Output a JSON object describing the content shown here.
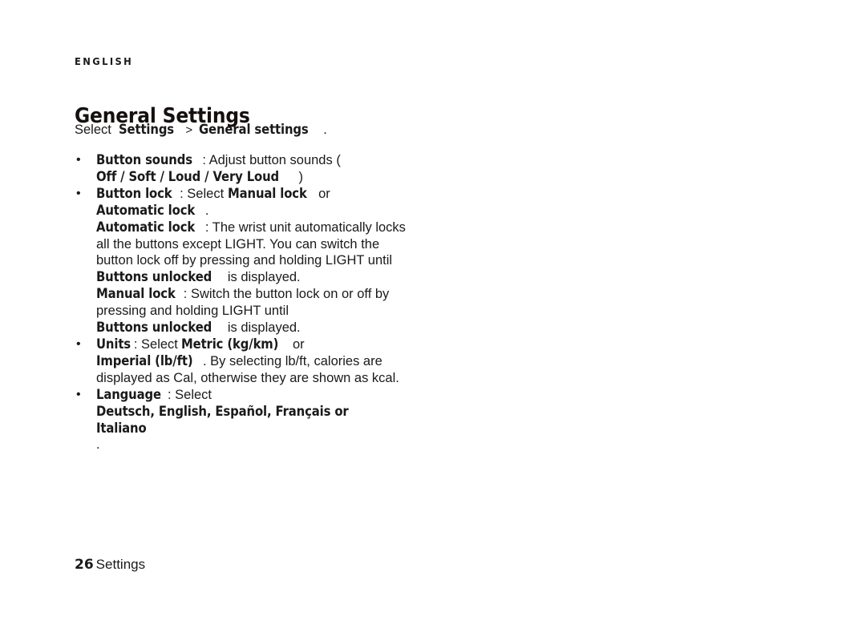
{
  "page": {
    "language_label": "ENGLISH",
    "title": "General Settings",
    "intro": {
      "lead": "Select",
      "path_1": "Settings",
      "separator": ">",
      "path_2": "General settings",
      "period": "."
    },
    "footer": {
      "page_number": "26",
      "section": "Settings"
    },
    "colors": {
      "background": "#ffffff",
      "text": "#1a1a1a"
    },
    "bullet_glyph": "•"
  },
  "settings_list": [
    {
      "name": "button-sounds",
      "term": "Button sounds",
      "colon": ":",
      "desc_lead": " Adjust button sounds (",
      "options_bold": "Off / Soft / Loud / Very Loud",
      "desc_tail": ")"
    },
    {
      "name": "button-lock",
      "term": "Button lock",
      "colon": ":",
      "desc_lead": " Select ",
      "option_a": "Manual lock",
      "conjunction": " or ",
      "option_b": "Automatic lock",
      "desc_tail": "."
    },
    {
      "name": "units",
      "term": "Units",
      "colon": ":",
      "desc_lead": " Select ",
      "option_a": "Metric (kg/km)",
      "conjunction": " or ",
      "option_b": "Imperial (lb/ft)",
      "desc_tail": ". By selecting lb/ft, calories are displayed as Cal, otherwise they are shown as kcal."
    },
    {
      "name": "language",
      "term": "Language",
      "colon": ":",
      "desc_lead": " Select ",
      "options_bold": "Deutsch, English, Español, Français or Italiano",
      "desc_tail": "."
    }
  ],
  "sub_paragraphs": [
    {
      "name": "automatic-lock",
      "term": "Automatic lock",
      "colon": ":",
      "text_1": " The wrist unit automatically locks all the buttons except LIGHT. You can switch the button lock off by pressing and holding LIGHT until ",
      "inline_bold": "Buttons unlocked",
      "text_2": " is displayed."
    },
    {
      "name": "manual-lock",
      "term": "Manual lock",
      "colon": ":",
      "text_1": " Switch the button lock on or off by pressing and holding LIGHT until ",
      "inline_bold": "Buttons unlocked",
      "text_2": " is displayed."
    }
  ]
}
